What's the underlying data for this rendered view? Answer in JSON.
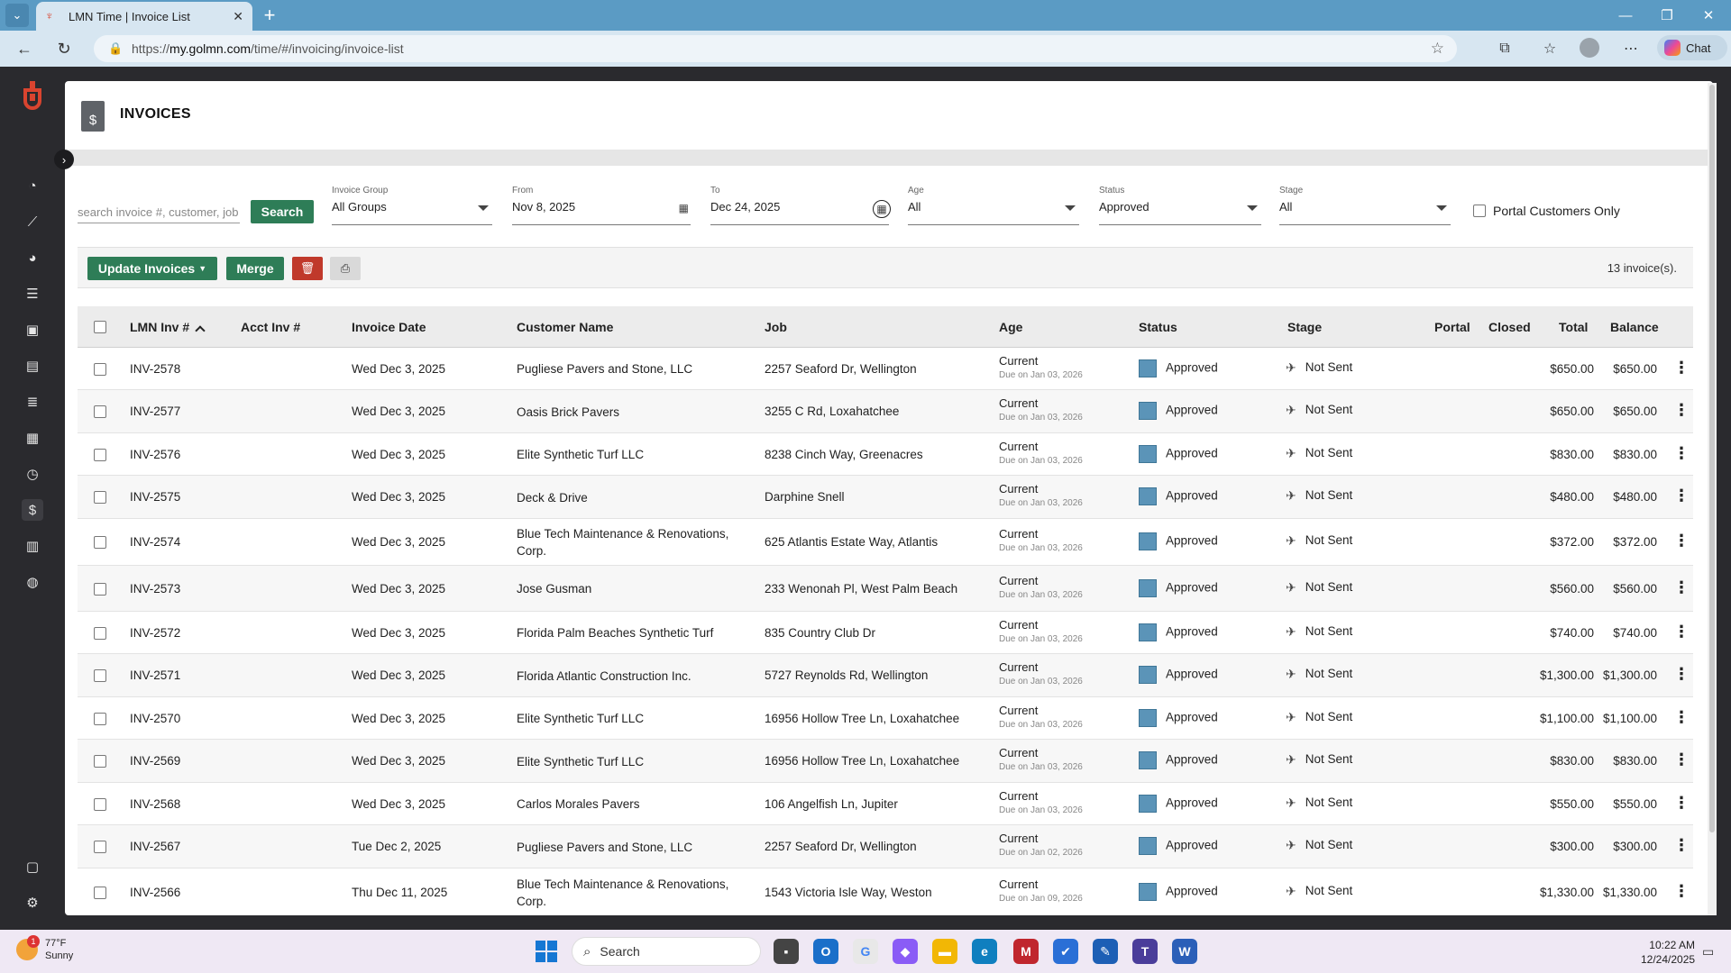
{
  "browser": {
    "tab_title": "LMN Time | Invoice List",
    "url_prefix": "https://",
    "url_domain": "my.golmn.com",
    "url_path": "/time/#/invoicing/invoice-list",
    "chat_label": "Chat"
  },
  "page": {
    "title": "INVOICES"
  },
  "filters": {
    "search_placeholder": "search invoice #, customer, job",
    "search_button": "Search",
    "invoice_group": {
      "label": "Invoice Group",
      "value": "All Groups"
    },
    "from": {
      "label": "From",
      "value": "Nov 8, 2025"
    },
    "to": {
      "label": "To",
      "value": "Dec 24, 2025"
    },
    "age": {
      "label": "Age",
      "value": "All"
    },
    "status": {
      "label": "Status",
      "value": "Approved"
    },
    "stage": {
      "label": "Stage",
      "value": "All"
    },
    "portal_only": "Portal Customers Only"
  },
  "toolbar": {
    "update_label": "Update Invoices",
    "merge_label": "Merge",
    "count": "13 invoice(s)."
  },
  "table": {
    "headers": {
      "lmn": "LMN Inv #",
      "acct": "Acct Inv #",
      "date": "Invoice Date",
      "customer": "Customer Name",
      "job": "Job",
      "age": "Age",
      "status": "Status",
      "stage": "Stage",
      "portal": "Portal",
      "closed": "Closed",
      "total": "Total",
      "balance": "Balance"
    },
    "rows": [
      {
        "inv": "INV-2578",
        "date": "Wed Dec 3, 2025",
        "customer": [
          "Pugliese Pavers and Stone, LLC"
        ],
        "job": "2257 Seaford Dr, Wellington",
        "age": "Current",
        "due": "Due on Jan 03, 2026",
        "status": "Approved",
        "stage": "Not Sent",
        "total": "$650.00",
        "balance": "$650.00"
      },
      {
        "inv": "INV-2577",
        "date": "Wed Dec 3, 2025",
        "customer": [
          "Oasis Brick Pavers"
        ],
        "job": "3255 C Rd, Loxahatchee",
        "age": "Current",
        "due": "Due on Jan 03, 2026",
        "status": "Approved",
        "stage": "Not Sent",
        "total": "$650.00",
        "balance": "$650.00"
      },
      {
        "inv": "INV-2576",
        "date": "Wed Dec 3, 2025",
        "customer": [
          "Elite Synthetic Turf LLC"
        ],
        "job": "8238 Cinch Way, Greenacres",
        "age": "Current",
        "due": "Due on Jan 03, 2026",
        "status": "Approved",
        "stage": "Not Sent",
        "total": "$830.00",
        "balance": "$830.00"
      },
      {
        "inv": "INV-2575",
        "date": "Wed Dec 3, 2025",
        "customer": [
          "Deck & Drive"
        ],
        "job": "Darphine Snell",
        "age": "Current",
        "due": "Due on Jan 03, 2026",
        "status": "Approved",
        "stage": "Not Sent",
        "total": "$480.00",
        "balance": "$480.00"
      },
      {
        "inv": "INV-2574",
        "date": "Wed Dec 3, 2025",
        "customer": [
          "Blue Tech Maintenance & Renovations,",
          "Corp."
        ],
        "job": "625 Atlantis Estate Way, Atlantis",
        "age": "Current",
        "due": "Due on Jan 03, 2026",
        "status": "Approved",
        "stage": "Not Sent",
        "total": "$372.00",
        "balance": "$372.00"
      },
      {
        "inv": "INV-2573",
        "date": "Wed Dec 3, 2025",
        "customer": [
          "Jose Gusman"
        ],
        "job": "233 Wenonah Pl, West Palm Beach",
        "age": "Current",
        "due": "Due on Jan 03, 2026",
        "status": "Approved",
        "stage": "Not Sent",
        "total": "$560.00",
        "balance": "$560.00"
      },
      {
        "inv": "INV-2572",
        "date": "Wed Dec 3, 2025",
        "customer": [
          "Florida Palm Beaches Synthetic Turf"
        ],
        "job": "835 Country Club Dr",
        "age": "Current",
        "due": "Due on Jan 03, 2026",
        "status": "Approved",
        "stage": "Not Sent",
        "total": "$740.00",
        "balance": "$740.00"
      },
      {
        "inv": "INV-2571",
        "date": "Wed Dec 3, 2025",
        "customer": [
          "Florida Atlantic Construction Inc."
        ],
        "job": "5727 Reynolds Rd, Wellington",
        "age": "Current",
        "due": "Due on Jan 03, 2026",
        "status": "Approved",
        "stage": "Not Sent",
        "total": "$1,300.00",
        "balance": "$1,300.00"
      },
      {
        "inv": "INV-2570",
        "date": "Wed Dec 3, 2025",
        "customer": [
          "Elite Synthetic Turf LLC"
        ],
        "job": "16956 Hollow Tree Ln, Loxahatchee",
        "age": "Current",
        "due": "Due on Jan 03, 2026",
        "status": "Approved",
        "stage": "Not Sent",
        "total": "$1,100.00",
        "balance": "$1,100.00"
      },
      {
        "inv": "INV-2569",
        "date": "Wed Dec 3, 2025",
        "customer": [
          "Elite Synthetic Turf LLC"
        ],
        "job": "16956 Hollow Tree Ln, Loxahatchee",
        "age": "Current",
        "due": "Due on Jan 03, 2026",
        "status": "Approved",
        "stage": "Not Sent",
        "total": "$830.00",
        "balance": "$830.00"
      },
      {
        "inv": "INV-2568",
        "date": "Wed Dec 3, 2025",
        "customer": [
          "Carlos Morales Pavers"
        ],
        "job": "106 Angelfish Ln, Jupiter",
        "age": "Current",
        "due": "Due on Jan 03, 2026",
        "status": "Approved",
        "stage": "Not Sent",
        "total": "$550.00",
        "balance": "$550.00"
      },
      {
        "inv": "INV-2567",
        "date": "Tue Dec 2, 2025",
        "customer": [
          "Pugliese Pavers and Stone, LLC"
        ],
        "job": "2257 Seaford Dr, Wellington",
        "age": "Current",
        "due": "Due on Jan 02, 2026",
        "status": "Approved",
        "stage": "Not Sent",
        "total": "$300.00",
        "balance": "$300.00"
      },
      {
        "inv": "INV-2566",
        "date": "Thu Dec 11, 2025",
        "customer": [
          "Blue Tech Maintenance & Renovations,",
          "Corp."
        ],
        "job": "1543 Victoria Isle Way, Weston",
        "age": "Current",
        "due": "Due on Jan 09, 2026",
        "status": "Approved",
        "stage": "Not Sent",
        "total": "$1,330.00",
        "balance": "$1,330.00"
      }
    ]
  },
  "taskbar": {
    "temp": "77°F",
    "condition": "Sunny",
    "weather_badge": "1",
    "search_label": "Search",
    "time": "10:22 AM",
    "date": "12/24/2025"
  },
  "colors": {
    "brand_green": "#2e7d57",
    "brand_red": "#d9442f",
    "status_approved": "#5b94b8"
  }
}
